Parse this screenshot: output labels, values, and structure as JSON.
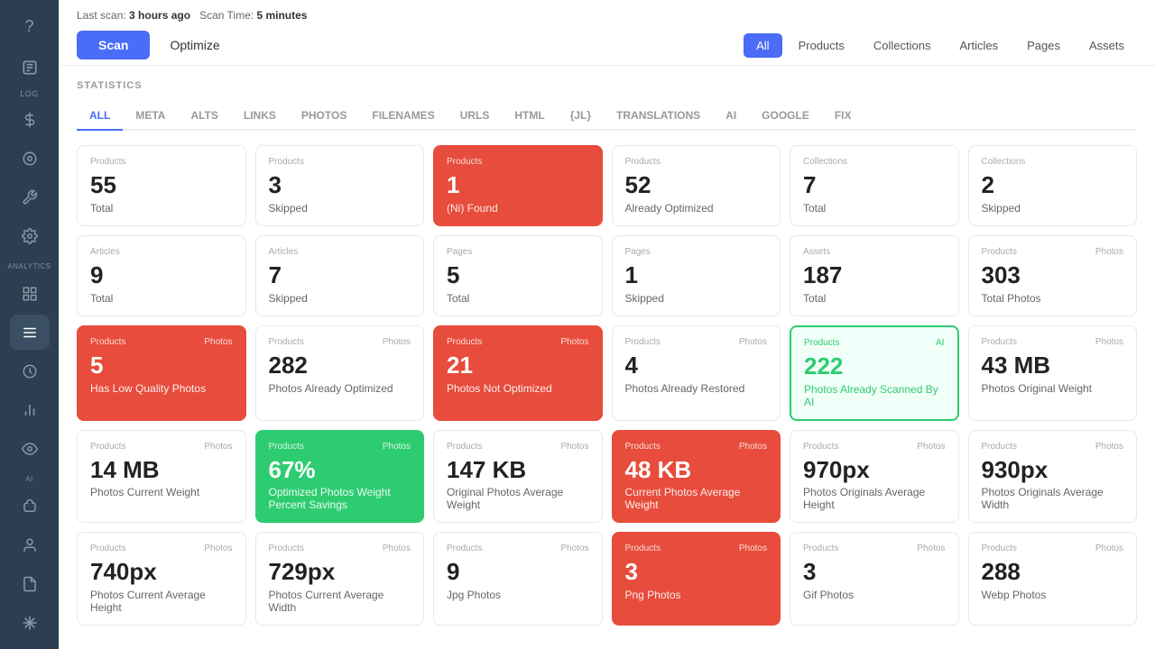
{
  "sidebar": {
    "icons": [
      {
        "name": "question-icon",
        "symbol": "?",
        "active": false
      },
      {
        "name": "log-icon",
        "symbol": "📋",
        "active": false,
        "label": "LOG"
      },
      {
        "name": "dollar-icon",
        "symbol": "$",
        "active": false
      },
      {
        "name": "circle-icon",
        "symbol": "⊙",
        "active": false
      },
      {
        "name": "wrench-icon",
        "symbol": "🔧",
        "active": false
      },
      {
        "name": "gear-icon",
        "symbol": "⚙",
        "active": false
      },
      {
        "name": "analytics-label",
        "label": "ANALYTICS"
      },
      {
        "name": "grid-icon",
        "symbol": "▤",
        "active": false
      },
      {
        "name": "list-icon",
        "symbol": "☰",
        "active": true
      },
      {
        "name": "clock-icon",
        "symbol": "🕐",
        "active": false
      },
      {
        "name": "chart-icon",
        "symbol": "📊",
        "active": false
      },
      {
        "name": "eye-icon",
        "symbol": "👁",
        "active": false
      },
      {
        "name": "ai-label",
        "label": "AI"
      },
      {
        "name": "brain-icon",
        "symbol": "🧠",
        "active": false
      },
      {
        "name": "person-icon",
        "symbol": "👤",
        "active": false
      },
      {
        "name": "history-icon",
        "symbol": "📜",
        "active": false
      },
      {
        "name": "settings-icon",
        "symbol": "✱",
        "active": false
      }
    ]
  },
  "topbar": {
    "scan_info": {
      "last_scan_label": "Last scan:",
      "last_scan_value": "3 hours ago",
      "scan_time_label": "Scan Time:",
      "scan_time_value": "5 minutes"
    },
    "buttons": {
      "scan": "Scan",
      "optimize": "Optimize"
    },
    "filter_tabs": [
      {
        "id": "all",
        "label": "All",
        "active": true
      },
      {
        "id": "products",
        "label": "Products",
        "active": false
      },
      {
        "id": "collections",
        "label": "Collections",
        "active": false
      },
      {
        "id": "articles",
        "label": "Articles",
        "active": false
      },
      {
        "id": "pages",
        "label": "Pages",
        "active": false
      },
      {
        "id": "assets",
        "label": "Assets",
        "active": false
      }
    ]
  },
  "stats_label": "STATISTICS",
  "sub_tabs": [
    {
      "id": "all",
      "label": "ALL",
      "active": true
    },
    {
      "id": "meta",
      "label": "META"
    },
    {
      "id": "alts",
      "label": "ALTS"
    },
    {
      "id": "links",
      "label": "LINKS"
    },
    {
      "id": "photos",
      "label": "PHOTOS"
    },
    {
      "id": "filenames",
      "label": "FILENAMES"
    },
    {
      "id": "urls",
      "label": "URLS"
    },
    {
      "id": "html",
      "label": "HTML"
    },
    {
      "id": "jl",
      "label": "{JL}"
    },
    {
      "id": "translations",
      "label": "TRANSLATIONS"
    },
    {
      "id": "ai",
      "label": "AI"
    },
    {
      "id": "google",
      "label": "GOOGLE"
    },
    {
      "id": "fix",
      "label": "FIX"
    }
  ],
  "stat_cards": {
    "row1": [
      {
        "cat": "Products",
        "cat2": "",
        "value": "55",
        "label": "Total",
        "style": "normal"
      },
      {
        "cat": "Products",
        "cat2": "",
        "value": "3",
        "label": "Skipped",
        "style": "normal"
      },
      {
        "cat": "Products",
        "cat2": "",
        "value": "1",
        "label": "(Ni) Found",
        "style": "red"
      },
      {
        "cat": "Products",
        "cat2": "",
        "value": "52",
        "label": "Already Optimized",
        "style": "normal"
      },
      {
        "cat": "Collections",
        "cat2": "",
        "value": "7",
        "label": "Total",
        "style": "normal"
      },
      {
        "cat": "Collections",
        "cat2": "",
        "value": "2",
        "label": "Skipped",
        "style": "normal"
      }
    ],
    "row2": [
      {
        "cat": "Articles",
        "cat2": "",
        "value": "9",
        "label": "Total",
        "style": "normal"
      },
      {
        "cat": "Articles",
        "cat2": "",
        "value": "7",
        "label": "Skipped",
        "style": "normal"
      },
      {
        "cat": "Pages",
        "cat2": "",
        "value": "5",
        "label": "Total",
        "style": "normal"
      },
      {
        "cat": "Pages",
        "cat2": "",
        "value": "1",
        "label": "Skipped",
        "style": "normal"
      },
      {
        "cat": "Assets",
        "cat2": "",
        "value": "187",
        "label": "Total",
        "style": "normal"
      },
      {
        "cat": "Products",
        "cat2": "Photos",
        "value": "303",
        "label": "Total Photos",
        "style": "normal"
      }
    ],
    "row3": [
      {
        "cat": "Products",
        "cat2": "Photos",
        "value": "5",
        "label": "Has Low Quality Photos",
        "style": "red"
      },
      {
        "cat": "Products",
        "cat2": "Photos",
        "value": "282",
        "label": "Photos Already Optimized",
        "style": "normal"
      },
      {
        "cat": "Products",
        "cat2": "Photos",
        "value": "21",
        "label": "Photos Not Optimized",
        "style": "red"
      },
      {
        "cat": "Products",
        "cat2": "Photos",
        "value": "4",
        "label": "Photos Already Restored",
        "style": "normal"
      },
      {
        "cat": "Products",
        "cat2": "AI",
        "value": "222",
        "label": "Photos Already Scanned By AI",
        "style": "teal-border"
      },
      {
        "cat": "Products",
        "cat2": "Photos",
        "value": "43 MB",
        "label": "Photos Original Weight",
        "style": "normal"
      }
    ],
    "row4": [
      {
        "cat": "Products",
        "cat2": "Photos",
        "value": "14 MB",
        "label": "Photos Current Weight",
        "style": "normal"
      },
      {
        "cat": "Products",
        "cat2": "Photos",
        "value": "67%",
        "label": "Optimized Photos Weight Percent Savings",
        "style": "green"
      },
      {
        "cat": "Products",
        "cat2": "Photos",
        "value": "147 KB",
        "label": "Original Photos Average Weight",
        "style": "normal"
      },
      {
        "cat": "Products",
        "cat2": "Photos",
        "value": "48 KB",
        "label": "Current Photos Average Weight",
        "style": "red"
      },
      {
        "cat": "Products",
        "cat2": "Photos",
        "value": "970px",
        "label": "Photos Originals Average Height",
        "style": "normal"
      },
      {
        "cat": "Products",
        "cat2": "Photos",
        "value": "930px",
        "label": "Photos Originals Average Width",
        "style": "normal"
      }
    ],
    "row5": [
      {
        "cat": "Products",
        "cat2": "Photos",
        "value": "740px",
        "label": "Photos Current Average Height",
        "style": "normal"
      },
      {
        "cat": "Products",
        "cat2": "Photos",
        "value": "729px",
        "label": "Photos Current Average Width",
        "style": "normal"
      },
      {
        "cat": "Products",
        "cat2": "Photos",
        "value": "9",
        "label": "Jpg Photos",
        "style": "normal"
      },
      {
        "cat": "Products",
        "cat2": "Photos",
        "value": "3",
        "label": "Png Photos",
        "style": "red"
      },
      {
        "cat": "Products",
        "cat2": "Photos",
        "value": "3",
        "label": "Gif Photos",
        "style": "normal"
      },
      {
        "cat": "Products",
        "cat2": "Photos",
        "value": "288",
        "label": "Webp Photos",
        "style": "normal"
      }
    ]
  }
}
